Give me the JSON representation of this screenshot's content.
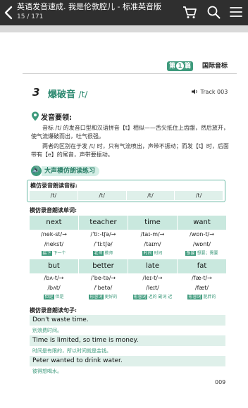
{
  "topbar": {
    "title": "英语发音速成. 我是伦敦腔儿 - 标准英音版",
    "page_indicator": "15 / 171"
  },
  "header": {
    "badge_prefix": "第",
    "badge_num": "1",
    "badge_suffix": "篇",
    "unit_title": "国际音标"
  },
  "section": {
    "number": "3",
    "title": "爆破音",
    "ipa": "/t/",
    "track": "Track 003"
  },
  "requirements": {
    "heading": "发音要领:",
    "para1_line1": "音标 /t/ 的发音口型和汉语拼音【t】相似——舌尖抵住上齿龈，然后放开，",
    "para1_line2": "使气流爆破而出，吐气很强。",
    "para2_line1": "两者的区别在于发 /t/ 时，只有气流喷出，声带不振动；而发【t】时，后面",
    "para2_line2": "带有【e】的尾音，声带要振动。"
  },
  "practice": {
    "icon": "🔊",
    "heading": "大声模仿朗读练习",
    "phonetic_label": "模仿录音朗读音标:",
    "phonetics": [
      "/t/",
      "/t/",
      "/t/",
      "/t/"
    ],
    "words_label": "模仿录音朗读单词:",
    "words_row1": [
      {
        "word": "next",
        "am": "/nek-st/→",
        "br": "/nekst/",
        "tag": "接下",
        "mean": "下一个"
      },
      {
        "word": "teacher",
        "am": "/ˈtiː-tʃə/→",
        "br": "/ˈtiːtʃə/",
        "tag": "老师",
        "mean": "教师"
      },
      {
        "word": "time",
        "am": "/taɪ-m/→",
        "br": "/taɪm/",
        "tag": "时间",
        "mean": "时间"
      },
      {
        "word": "want",
        "am": "/wɒn-t/→",
        "br": "/wɒnt/",
        "tag": "想要",
        "mean": "想要；需要"
      }
    ],
    "words_row2": [
      {
        "word": "but",
        "am": "/bʌ-t/→",
        "br": "/bʌt/",
        "tag": "但是",
        "mean": "但是"
      },
      {
        "word": "better",
        "am": "/ˈbe-tə/→",
        "br": "/ˈbetə/",
        "tag": "形容词",
        "mean": "更好的"
      },
      {
        "word": "late",
        "am": "/leɪ-t/→",
        "br": "/leɪt/",
        "tag": "形容词",
        "mean": "迟的 副词 迟"
      },
      {
        "word": "fat",
        "am": "/fæ-t/→",
        "br": "/fæt/",
        "tag": "形容词",
        "mean": "肥胖的"
      }
    ],
    "sentences_label": "模仿录音朗读句子:",
    "sentences": [
      {
        "en": "Don't waste time.",
        "cn": "别浪费时间。"
      },
      {
        "en": "Time is limited, so time is money.",
        "cn": "时间是有限的，所以时间就是金钱。"
      },
      {
        "en": "Peter wanted to drink water.",
        "cn": "彼得想喝水。"
      }
    ]
  },
  "footer": {
    "page_number": "009"
  },
  "colors": {
    "accent": "#3e9a7c",
    "topbar": "#2f2f2f",
    "cell": "#c9e8de"
  }
}
